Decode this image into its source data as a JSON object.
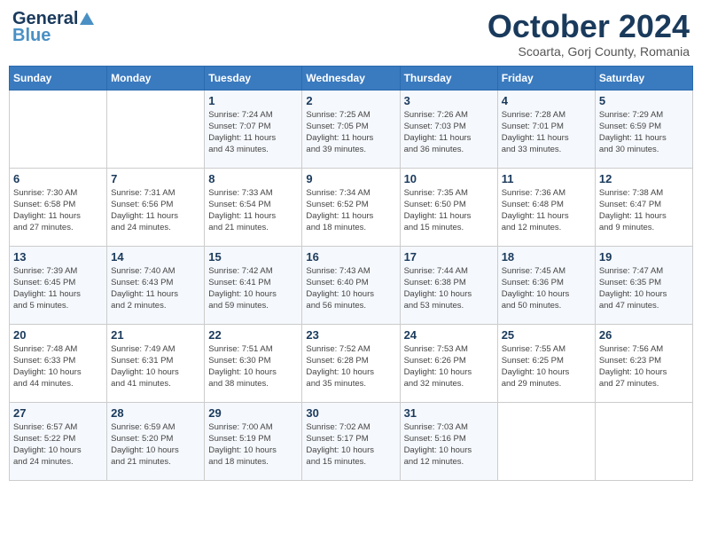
{
  "header": {
    "logo_line1": "General",
    "logo_line2": "Blue",
    "month_title": "October 2024",
    "subtitle": "Scoarta, Gorj County, Romania"
  },
  "days_of_week": [
    "Sunday",
    "Monday",
    "Tuesday",
    "Wednesday",
    "Thursday",
    "Friday",
    "Saturday"
  ],
  "weeks": [
    [
      {
        "day": "",
        "info": ""
      },
      {
        "day": "",
        "info": ""
      },
      {
        "day": "1",
        "info": "Sunrise: 7:24 AM\nSunset: 7:07 PM\nDaylight: 11 hours\nand 43 minutes."
      },
      {
        "day": "2",
        "info": "Sunrise: 7:25 AM\nSunset: 7:05 PM\nDaylight: 11 hours\nand 39 minutes."
      },
      {
        "day": "3",
        "info": "Sunrise: 7:26 AM\nSunset: 7:03 PM\nDaylight: 11 hours\nand 36 minutes."
      },
      {
        "day": "4",
        "info": "Sunrise: 7:28 AM\nSunset: 7:01 PM\nDaylight: 11 hours\nand 33 minutes."
      },
      {
        "day": "5",
        "info": "Sunrise: 7:29 AM\nSunset: 6:59 PM\nDaylight: 11 hours\nand 30 minutes."
      }
    ],
    [
      {
        "day": "6",
        "info": "Sunrise: 7:30 AM\nSunset: 6:58 PM\nDaylight: 11 hours\nand 27 minutes."
      },
      {
        "day": "7",
        "info": "Sunrise: 7:31 AM\nSunset: 6:56 PM\nDaylight: 11 hours\nand 24 minutes."
      },
      {
        "day": "8",
        "info": "Sunrise: 7:33 AM\nSunset: 6:54 PM\nDaylight: 11 hours\nand 21 minutes."
      },
      {
        "day": "9",
        "info": "Sunrise: 7:34 AM\nSunset: 6:52 PM\nDaylight: 11 hours\nand 18 minutes."
      },
      {
        "day": "10",
        "info": "Sunrise: 7:35 AM\nSunset: 6:50 PM\nDaylight: 11 hours\nand 15 minutes."
      },
      {
        "day": "11",
        "info": "Sunrise: 7:36 AM\nSunset: 6:48 PM\nDaylight: 11 hours\nand 12 minutes."
      },
      {
        "day": "12",
        "info": "Sunrise: 7:38 AM\nSunset: 6:47 PM\nDaylight: 11 hours\nand 9 minutes."
      }
    ],
    [
      {
        "day": "13",
        "info": "Sunrise: 7:39 AM\nSunset: 6:45 PM\nDaylight: 11 hours\nand 5 minutes."
      },
      {
        "day": "14",
        "info": "Sunrise: 7:40 AM\nSunset: 6:43 PM\nDaylight: 11 hours\nand 2 minutes."
      },
      {
        "day": "15",
        "info": "Sunrise: 7:42 AM\nSunset: 6:41 PM\nDaylight: 10 hours\nand 59 minutes."
      },
      {
        "day": "16",
        "info": "Sunrise: 7:43 AM\nSunset: 6:40 PM\nDaylight: 10 hours\nand 56 minutes."
      },
      {
        "day": "17",
        "info": "Sunrise: 7:44 AM\nSunset: 6:38 PM\nDaylight: 10 hours\nand 53 minutes."
      },
      {
        "day": "18",
        "info": "Sunrise: 7:45 AM\nSunset: 6:36 PM\nDaylight: 10 hours\nand 50 minutes."
      },
      {
        "day": "19",
        "info": "Sunrise: 7:47 AM\nSunset: 6:35 PM\nDaylight: 10 hours\nand 47 minutes."
      }
    ],
    [
      {
        "day": "20",
        "info": "Sunrise: 7:48 AM\nSunset: 6:33 PM\nDaylight: 10 hours\nand 44 minutes."
      },
      {
        "day": "21",
        "info": "Sunrise: 7:49 AM\nSunset: 6:31 PM\nDaylight: 10 hours\nand 41 minutes."
      },
      {
        "day": "22",
        "info": "Sunrise: 7:51 AM\nSunset: 6:30 PM\nDaylight: 10 hours\nand 38 minutes."
      },
      {
        "day": "23",
        "info": "Sunrise: 7:52 AM\nSunset: 6:28 PM\nDaylight: 10 hours\nand 35 minutes."
      },
      {
        "day": "24",
        "info": "Sunrise: 7:53 AM\nSunset: 6:26 PM\nDaylight: 10 hours\nand 32 minutes."
      },
      {
        "day": "25",
        "info": "Sunrise: 7:55 AM\nSunset: 6:25 PM\nDaylight: 10 hours\nand 29 minutes."
      },
      {
        "day": "26",
        "info": "Sunrise: 7:56 AM\nSunset: 6:23 PM\nDaylight: 10 hours\nand 27 minutes."
      }
    ],
    [
      {
        "day": "27",
        "info": "Sunrise: 6:57 AM\nSunset: 5:22 PM\nDaylight: 10 hours\nand 24 minutes."
      },
      {
        "day": "28",
        "info": "Sunrise: 6:59 AM\nSunset: 5:20 PM\nDaylight: 10 hours\nand 21 minutes."
      },
      {
        "day": "29",
        "info": "Sunrise: 7:00 AM\nSunset: 5:19 PM\nDaylight: 10 hours\nand 18 minutes."
      },
      {
        "day": "30",
        "info": "Sunrise: 7:02 AM\nSunset: 5:17 PM\nDaylight: 10 hours\nand 15 minutes."
      },
      {
        "day": "31",
        "info": "Sunrise: 7:03 AM\nSunset: 5:16 PM\nDaylight: 10 hours\nand 12 minutes."
      },
      {
        "day": "",
        "info": ""
      },
      {
        "day": "",
        "info": ""
      }
    ]
  ]
}
